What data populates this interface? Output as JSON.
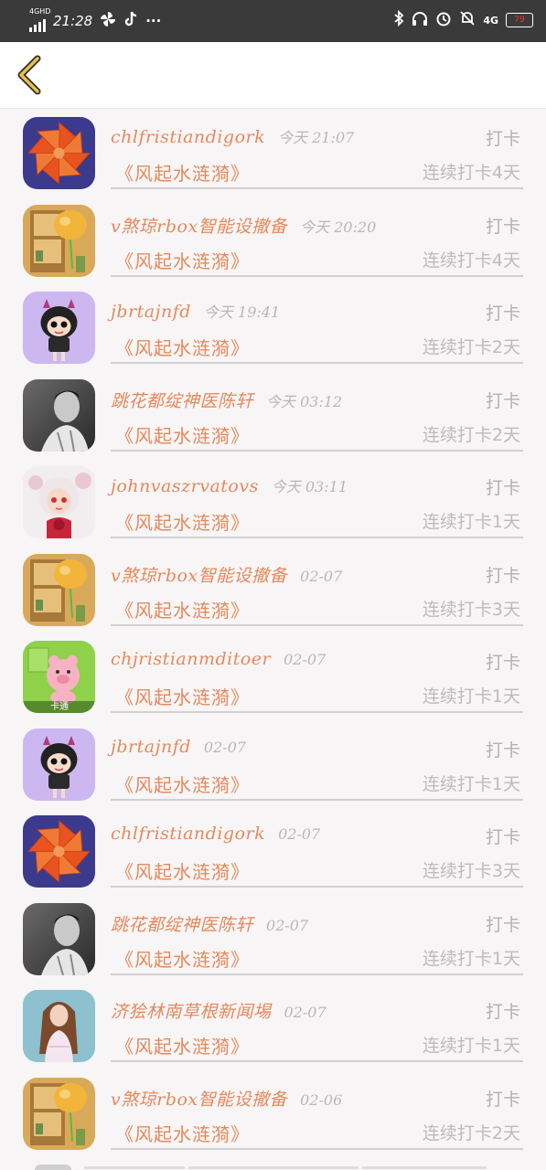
{
  "status_bar": {
    "network": "4GHD",
    "time": "21:28",
    "icons_left": [
      "pinwheel-icon",
      "tiktok-icon",
      "more-icon"
    ],
    "icons_right": [
      "bluetooth-icon",
      "headphones-icon",
      "alarm-icon",
      "mute-icon",
      "signal-4g-icon",
      "battery-icon"
    ],
    "network_right": "4G",
    "battery": "79"
  },
  "header": {
    "back_icon": "chevron-left-icon",
    "accent_color": "#e8c14a"
  },
  "colors": {
    "name": "#e48a5c",
    "muted": "#b9b6b7",
    "background": "#f7f5f6"
  },
  "items": [
    {
      "name": "chlfristiandigork",
      "time": "今天 21:07",
      "action": "打卡",
      "book": "《风起水涟漪》",
      "streak": "连续打卡4天",
      "avatar": "origami-flower"
    },
    {
      "name": "v煞琼rbox智能设撤备",
      "time": "今天 20:20",
      "action": "打卡",
      "book": "《风起水涟漪》",
      "streak": "连续打卡4天",
      "avatar": "shelf-balloon"
    },
    {
      "name": "jbrtajnfd",
      "time": "今天 19:41",
      "action": "打卡",
      "book": "《风起水涟漪》",
      "streak": "连续打卡2天",
      "avatar": "cartoon-girl"
    },
    {
      "name": "跳花都绽神医陈轩",
      "time": "今天 03:12",
      "action": "打卡",
      "book": "《风起水涟漪》",
      "streak": "连续打卡2天",
      "avatar": "man-portrait"
    },
    {
      "name": "johnvaszrvatovs",
      "time": "今天 03:11",
      "action": "打卡",
      "book": "《风起水涟漪》",
      "streak": "连续打卡1天",
      "avatar": "anime-girl"
    },
    {
      "name": "v煞琼rbox智能设撤备",
      "time": "02-07",
      "action": "打卡",
      "book": "《风起水涟漪》",
      "streak": "连续打卡3天",
      "avatar": "shelf-balloon"
    },
    {
      "name": "chjristianmditoer",
      "time": "02-07",
      "action": "打卡",
      "book": "《风起水涟漪》",
      "streak": "连续打卡1天",
      "avatar": "pink-pig",
      "avatar_tag": "卡通"
    },
    {
      "name": "jbrtajnfd",
      "time": "02-07",
      "action": "打卡",
      "book": "《风起水涟漪》",
      "streak": "连续打卡1天",
      "avatar": "cartoon-girl"
    },
    {
      "name": "chlfristiandigork",
      "time": "02-07",
      "action": "打卡",
      "book": "《风起水涟漪》",
      "streak": "连续打卡3天",
      "avatar": "origami-flower"
    },
    {
      "name": "跳花都绽神医陈轩",
      "time": "02-07",
      "action": "打卡",
      "book": "《风起水涟漪》",
      "streak": "连续打卡1天",
      "avatar": "man-portrait"
    },
    {
      "name": "济狯林南草根新闻埸",
      "time": "02-07",
      "action": "打卡",
      "book": "《风起水涟漪》",
      "streak": "连续打卡1天",
      "avatar": "woman-photo"
    },
    {
      "name": "v煞琼rbox智能设撤备",
      "time": "02-06",
      "action": "打卡",
      "book": "《风起水涟漪》",
      "streak": "连续打卡2天",
      "avatar": "shelf-balloon"
    }
  ]
}
